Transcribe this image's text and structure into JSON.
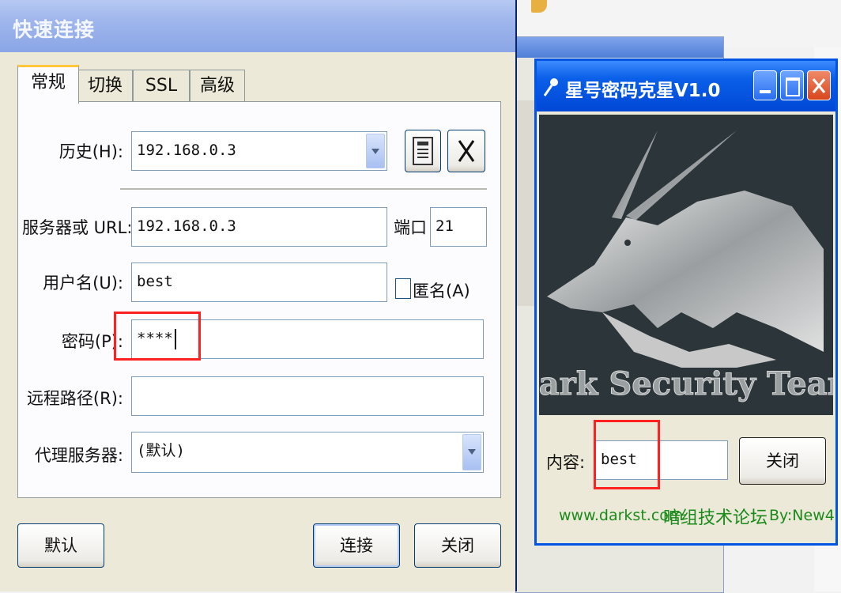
{
  "quick_connect": {
    "title": "快速连接",
    "tabs": [
      "常规",
      "切换",
      "SSL",
      "高级"
    ],
    "history_label": "历史(H):",
    "history_value": "192.168.0.3",
    "server_label": "服务器或 URL:",
    "server_value": "192.168.0.3",
    "port_label": "端口",
    "port_value": "21",
    "username_label": "用户名(U):",
    "username_value": "best",
    "anonymous_label": "匿名(A)",
    "password_label": "密码(P):",
    "password_value": "****",
    "remote_path_label": "远程路径(R):",
    "remote_path_value": "",
    "proxy_label": "代理服务器:",
    "proxy_value": "(默认)",
    "default_button": "默认",
    "connect_button": "连接",
    "close_button": "关闭"
  },
  "cracker": {
    "title": "星号密码克星V1.0",
    "banner_text": "Dark Security Team",
    "content_label": "内容:",
    "content_value": "best",
    "close_button": "关闭",
    "footer_url": "www.darkst.com",
    "footer_forum": "暗组技术论坛",
    "footer_by": "By:New4"
  },
  "colors": {
    "highlight_red": "#ff2020",
    "footer_green": "#1a8a1a",
    "xp_blue": "#0054e3"
  }
}
